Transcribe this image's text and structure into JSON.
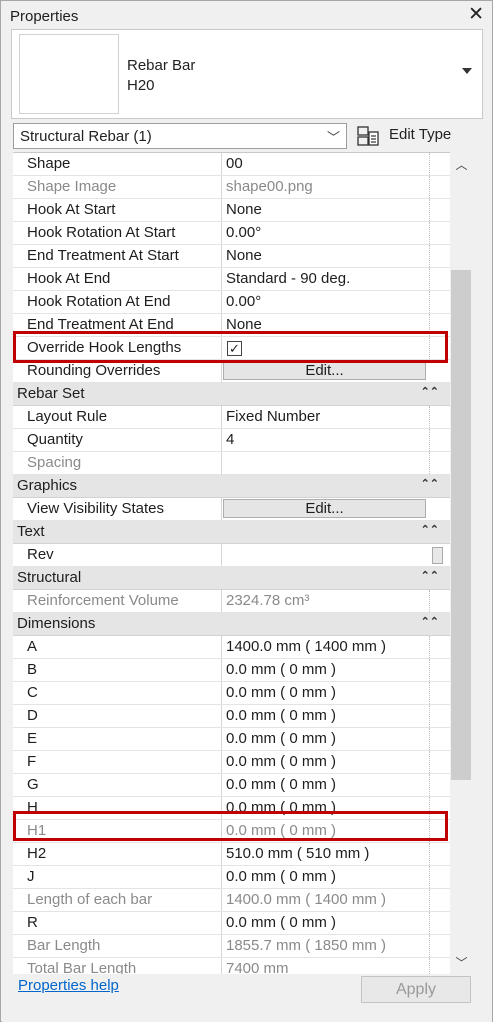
{
  "window": {
    "title": "Properties",
    "close_icon": "close-icon"
  },
  "type_selector": {
    "family": "Rebar Bar",
    "type": "H20"
  },
  "filter": {
    "selected": "Structural Rebar (1)",
    "edit_type_label": "Edit Type"
  },
  "rows": [
    {
      "label": "Shape",
      "value": "00"
    },
    {
      "label": "Shape Image",
      "value": "shape00.png"
    },
    {
      "label": "Hook At Start",
      "value": "None"
    },
    {
      "label": "Hook Rotation At Start",
      "value": "0.00°"
    },
    {
      "label": "End Treatment At Start",
      "value": "None"
    },
    {
      "label": "Hook At End",
      "value": "Standard - 90 deg."
    },
    {
      "label": "Hook Rotation At End",
      "value": "0.00°"
    },
    {
      "label": "End Treatment At End",
      "value": "None"
    },
    {
      "label": "Override Hook Lengths",
      "value": "✓"
    },
    {
      "label": "Rounding Overrides",
      "value": "Edit..."
    },
    {
      "label": "Rebar Set",
      "value": ""
    },
    {
      "label": "Layout Rule",
      "value": "Fixed Number"
    },
    {
      "label": "Quantity",
      "value": "4"
    },
    {
      "label": "Spacing",
      "value": ""
    },
    {
      "label": "Graphics",
      "value": ""
    },
    {
      "label": "View Visibility States",
      "value": "Edit..."
    },
    {
      "label": "Text",
      "value": ""
    },
    {
      "label": "Rev",
      "value": ""
    },
    {
      "label": "Structural",
      "value": ""
    },
    {
      "label": "Reinforcement Volume",
      "value": "2324.78 cm³"
    },
    {
      "label": "Dimensions",
      "value": ""
    },
    {
      "label": "A",
      "value": "1400.0 mm ( 1400 mm )"
    },
    {
      "label": "B",
      "value": "0.0 mm ( 0 mm )"
    },
    {
      "label": "C",
      "value": "0.0 mm ( 0 mm )"
    },
    {
      "label": "D",
      "value": "0.0 mm ( 0 mm )"
    },
    {
      "label": "E",
      "value": "0.0 mm ( 0 mm )"
    },
    {
      "label": "F",
      "value": "0.0 mm ( 0 mm )"
    },
    {
      "label": "G",
      "value": "0.0 mm ( 0 mm )"
    },
    {
      "label": "H",
      "value": "0.0 mm ( 0 mm )"
    },
    {
      "label": "H1",
      "value": "0.0 mm ( 0 mm )"
    },
    {
      "label": "H2",
      "value": "510.0 mm ( 510 mm )"
    },
    {
      "label": "J",
      "value": "0.0 mm ( 0 mm )"
    },
    {
      "label": "Length of each bar",
      "value": "1400.0 mm ( 1400 mm )"
    },
    {
      "label": "R",
      "value": "0.0 mm ( 0 mm )"
    },
    {
      "label": "Bar Length",
      "value": "1855.7 mm ( 1850 mm )"
    },
    {
      "label": "Total Bar Length",
      "value": "7400 mm"
    }
  ],
  "footer": {
    "help": "Properties help",
    "apply": "Apply"
  },
  "colors": {
    "highlight": "#c00000",
    "link": "#0066cc",
    "group_bg": "#e5e5e5"
  }
}
